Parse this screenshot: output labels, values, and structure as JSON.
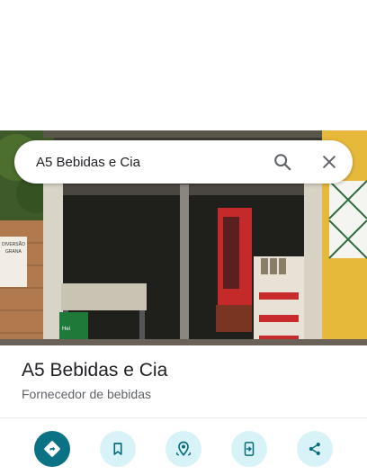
{
  "search": {
    "query": "A5 Bebidas e Cia"
  },
  "place": {
    "name": "A5 Bebidas e Cia",
    "category": "Fornecedor de bebidas"
  },
  "photo": {
    "signs": {
      "poster_line1": "DIVERSÃO",
      "poster_line2": "GRANA",
      "crate_label": "Heineken"
    }
  },
  "actions": [
    {
      "icon": "directions-icon"
    },
    {
      "icon": "bookmark-icon"
    },
    {
      "icon": "nearby-pin-icon"
    },
    {
      "icon": "send-to-phone-icon"
    },
    {
      "icon": "share-icon"
    }
  ],
  "colors": {
    "primary_action": "#0b7285",
    "action_bg": "#d8f3f8",
    "action_icon": "#0b6b7c",
    "wall_yellow": "#e6b93b"
  }
}
